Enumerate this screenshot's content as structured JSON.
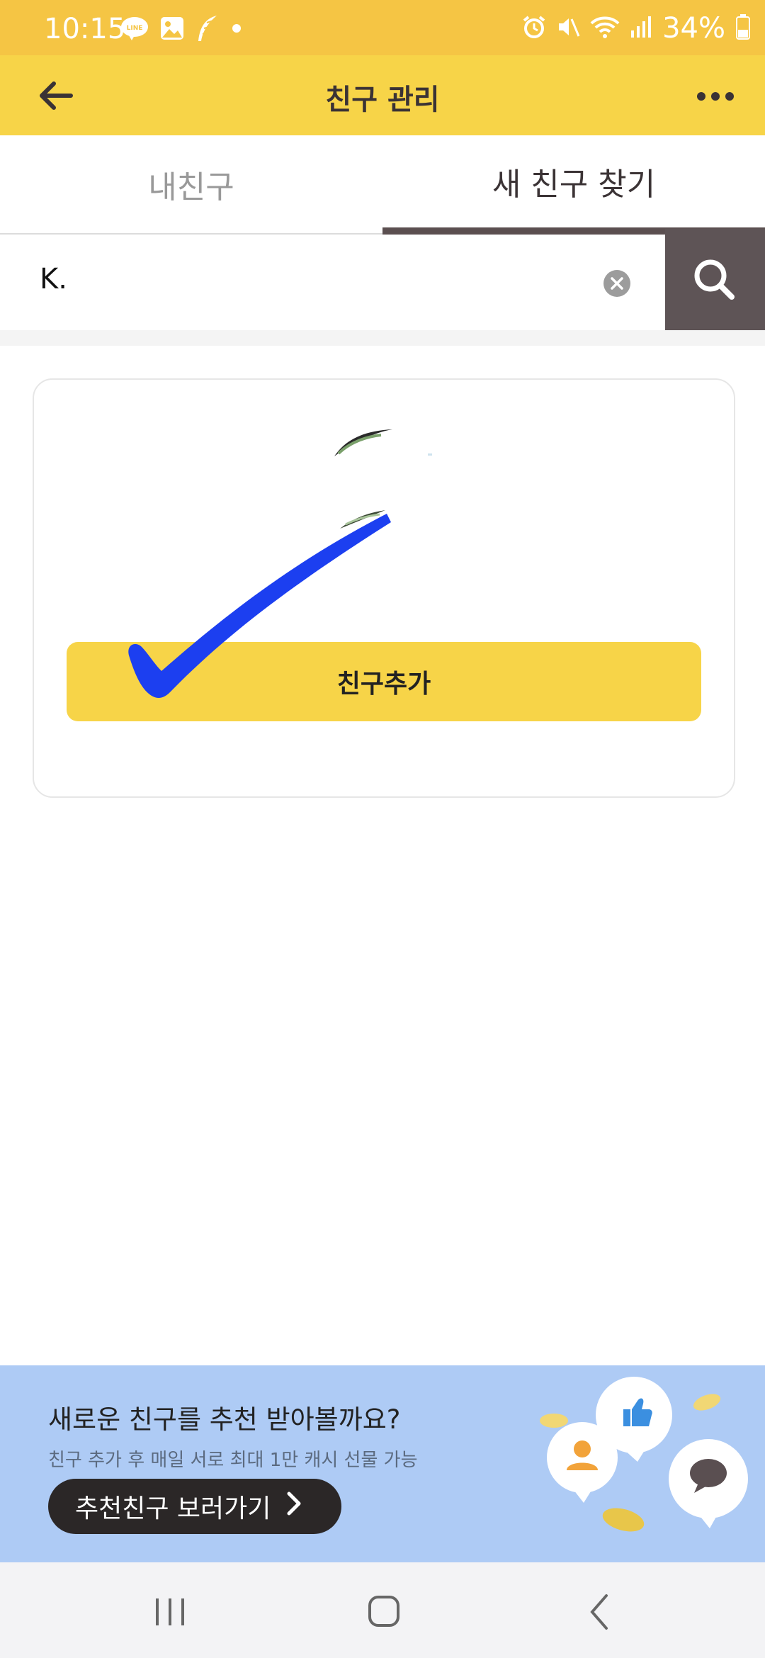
{
  "status_bar": {
    "time": "10:15",
    "battery": "34%",
    "notification_icons": [
      "line-icon",
      "gallery-icon",
      "feather-icon",
      "dot-icon"
    ],
    "system_icons": [
      "alarm-icon",
      "mute-icon",
      "wifi-icon",
      "signal-icon",
      "battery-icon"
    ]
  },
  "header": {
    "title": "친구 관리"
  },
  "tabs": [
    {
      "label": "내친구",
      "selected": false
    },
    {
      "label": "새 친구 찾기",
      "selected": true
    }
  ],
  "search": {
    "value": "K."
  },
  "result_card": {
    "name_fragment": "...",
    "add_button_label": "친구추가"
  },
  "banner": {
    "headline": "새로운 친구를 추천 받아볼까요?",
    "subtext": "친구 추가 후 매일 서로 최대 1만 캐시 선물 가능",
    "cta_label": "추천친구 보러가기"
  },
  "colors": {
    "header_bg": "#f7d448",
    "status_bg": "#f5c544",
    "accent_dark": "#5e5456",
    "banner_bg": "#aecbf5",
    "checkmark": "#1c3ff0"
  }
}
